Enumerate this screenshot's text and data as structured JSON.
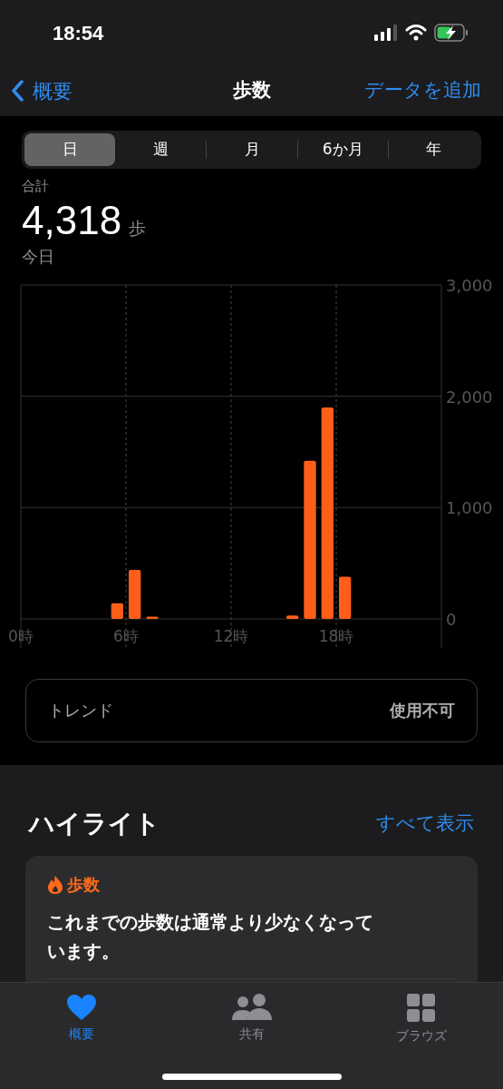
{
  "status_bar": {
    "time": "18:54"
  },
  "nav": {
    "back": "概要",
    "title": "歩数",
    "action": "データを追加"
  },
  "segments": [
    {
      "label": "日",
      "selected": true
    },
    {
      "label": "週",
      "selected": false
    },
    {
      "label": "月",
      "selected": false
    },
    {
      "label": "6か月",
      "selected": false
    },
    {
      "label": "年",
      "selected": false
    }
  ],
  "summary": {
    "label": "合計",
    "value": "4,318",
    "unit": "歩",
    "date": "今日"
  },
  "chart_data": {
    "type": "bar",
    "x": [
      5.5,
      6.5,
      7.5,
      15.5,
      16.5,
      17.5,
      18.5
    ],
    "xlim": [
      0,
      24
    ],
    "grid": true,
    "series": [
      {
        "color": "#ff5e1a",
        "values": [
          140,
          440,
          20,
          30,
          1420,
          1900,
          380
        ]
      }
    ],
    "ylim": [
      0,
      3000
    ],
    "yticks": [
      {
        "value": 0,
        "label": "0"
      },
      {
        "value": 1000,
        "label": "1,000"
      },
      {
        "value": 2000,
        "label": "2,000"
      },
      {
        "value": 3000,
        "label": "3,000"
      }
    ],
    "xticks": [
      {
        "value": 0,
        "label": "0時"
      },
      {
        "value": 6,
        "label": "6時"
      },
      {
        "value": 12,
        "label": "12時"
      },
      {
        "value": 18,
        "label": "18時"
      }
    ]
  },
  "trend": {
    "label": "トレンド",
    "value": "使用不可"
  },
  "highlights": {
    "title": "ハイライト",
    "link": "すべて表示",
    "card": {
      "category": "歩数",
      "text": "これまでの歩数は通常より少なくなっています。"
    }
  },
  "tab_bar": [
    {
      "kind": "heart",
      "label": "概要",
      "selected": true
    },
    {
      "kind": "people",
      "label": "共有",
      "selected": false
    },
    {
      "kind": "grid",
      "label": "ブラウズ",
      "selected": false
    }
  ]
}
